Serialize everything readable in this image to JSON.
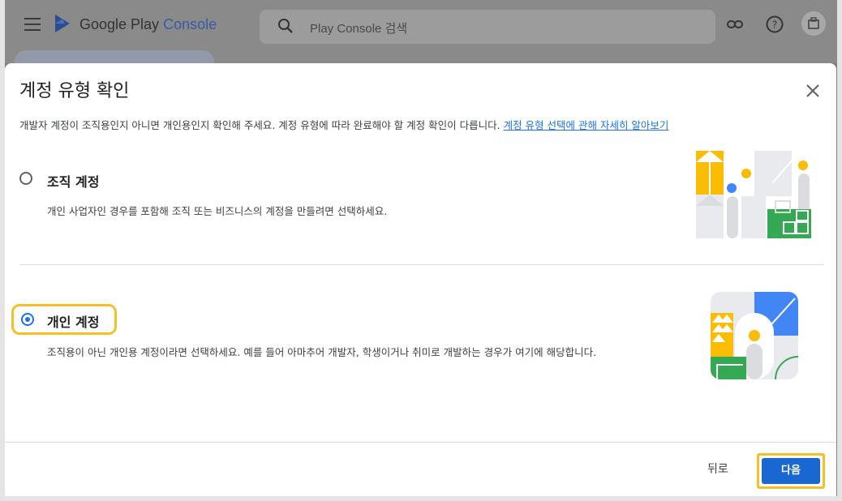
{
  "app": {
    "logo_text": "Google Play",
    "logo_console": "Console",
    "search_placeholder": "Play Console 검색",
    "icons": [
      "menu-icon",
      "link-icon",
      "help-icon",
      "account-icon"
    ]
  },
  "dialog": {
    "title": "계정 유형 확인",
    "description": "개발자 계정이 조직용인지 아니면 개인용인지 확인해 주세요. 계정 유형에 따라 완료해야 할 계정 확인이 다릅니다.",
    "learn_more_link": "계정 유형 선택에 관해 자세히 알아보기",
    "options": [
      {
        "label": "조직 계정",
        "description": "개인 사업자인 경우를 포함해 조직 또는 비즈니스의 계정을 만들려면 선택하세요.",
        "selected": false
      },
      {
        "label": "개인 계정",
        "description": "조직용이 아닌 개인용 계정이라면 선택하세요. 예를 들어 아마추어 개발자, 학생이거나 취미로 개발하는 경우가 여기에 해당합니다.",
        "selected": true
      }
    ],
    "back_label": "뒤로",
    "next_label": "다음"
  },
  "colors": {
    "primary": "#1a73e8",
    "button": "#1967d2",
    "highlight": "#f6bf26",
    "google_yellow": "#fbbc04",
    "google_green": "#34a853",
    "google_blue": "#4285f4"
  }
}
